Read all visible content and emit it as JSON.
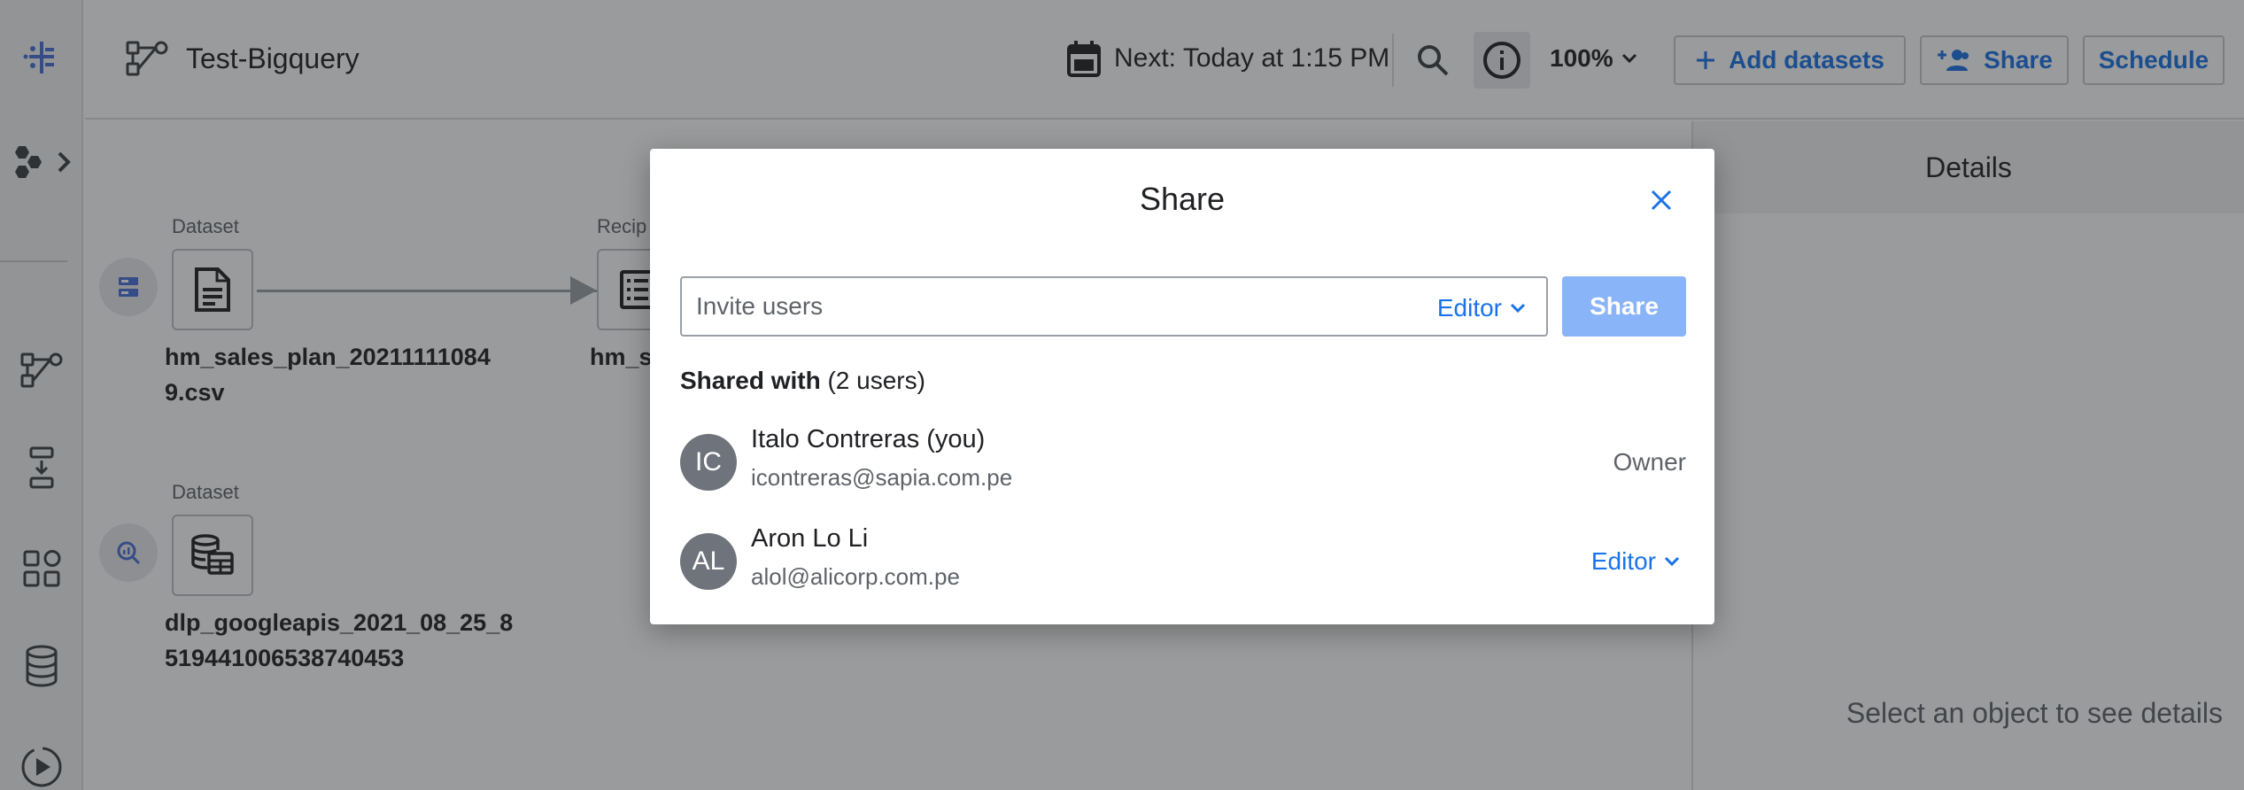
{
  "header": {
    "flow_title": "Test-Bigquery",
    "next_run": "Next: Today at 1:15 PM",
    "zoom": "100%",
    "add_datasets_label": "Add datasets",
    "share_label": "Share",
    "schedule_label": "Schedule"
  },
  "canvas": {
    "nodes": [
      {
        "type_label": "Dataset",
        "name_line1": "hm_sales_plan_20211111084",
        "name_line2": "9.csv"
      },
      {
        "type_label": "Recip",
        "name_line1": "hm_s"
      },
      {
        "type_label": "Dataset",
        "name_line1": "dlp_googleapis_2021_08_25_8",
        "name_line2": "519441006538740453"
      }
    ]
  },
  "details": {
    "title": "Details",
    "empty_text": "Select an object to see details"
  },
  "modal": {
    "title": "Share",
    "invite_placeholder": "Invite users",
    "invite_role": "Editor",
    "share_button": "Share",
    "shared_with_label": "Shared with",
    "shared_count": "(2 users)",
    "users": [
      {
        "initials": "IC",
        "name": "Italo Contreras (you)",
        "email": "icontreras@sapia.com.pe",
        "role": "Owner"
      },
      {
        "initials": "AL",
        "name": "Aron Lo Li",
        "email": "alol@alicorp.com.pe",
        "role": "Editor"
      }
    ]
  },
  "colors": {
    "accent": "#1a73e8",
    "share_disabled": "#8ab4f8",
    "avatar": "#6f747c",
    "overlay": "rgba(32,33,36,0.45)"
  }
}
